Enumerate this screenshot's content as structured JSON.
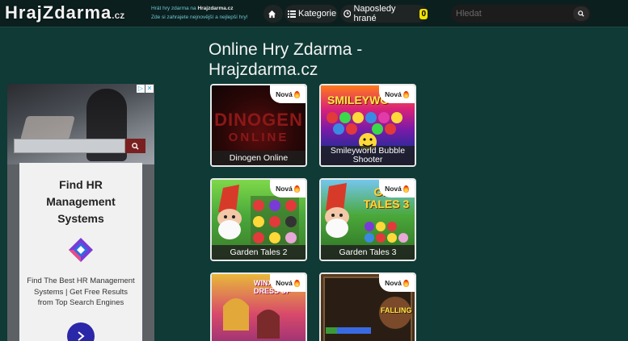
{
  "header": {
    "logo_text": "HrajZdarma",
    "logo_suffix": ".cz",
    "tagline_prefix": "Hrát hry zdarma na ",
    "tagline_site": "Hrajzdarma.cz",
    "tagline_rest": "Zde si zahrajete nejnovější a nejlepší hry!",
    "nav": {
      "home_icon": "home-icon",
      "categories_label": "Kategorie",
      "last_played_label": "Naposledy hrané",
      "last_played_count": "0"
    },
    "search": {
      "placeholder": "Hledat",
      "value": ""
    }
  },
  "page_title": "Online Hry Zdarma - Hrajzdarma.cz",
  "ad": {
    "headline": "Find HR Management Systems",
    "body": "Find The Best HR Management Systems | Get Free Results from Top Search Engines"
  },
  "games": [
    {
      "title": "Dinogen Online",
      "badge": "Nová",
      "art_top": "DINOGEN",
      "art_bottom": "ONLINE"
    },
    {
      "title": "Smileyworld Bubble Shooter",
      "badge": "Nová",
      "art_top": "SMILEYWO"
    },
    {
      "title": "Garden Tales 2",
      "badge": "Nová"
    },
    {
      "title": "Garden Tales 3",
      "badge": "Nová",
      "art_top": "GAR TALES 3"
    },
    {
      "title": "",
      "badge": "Nová",
      "art_top": "WINX DRESS UP"
    },
    {
      "title": "",
      "badge": "Nová",
      "art_top": "FALLING"
    }
  ],
  "colors": {
    "page_bg": "#0f3a36",
    "header_bg": "#0b1f1e",
    "badge_yellow": "#f2e200",
    "card_border": "#e9e9e9"
  }
}
